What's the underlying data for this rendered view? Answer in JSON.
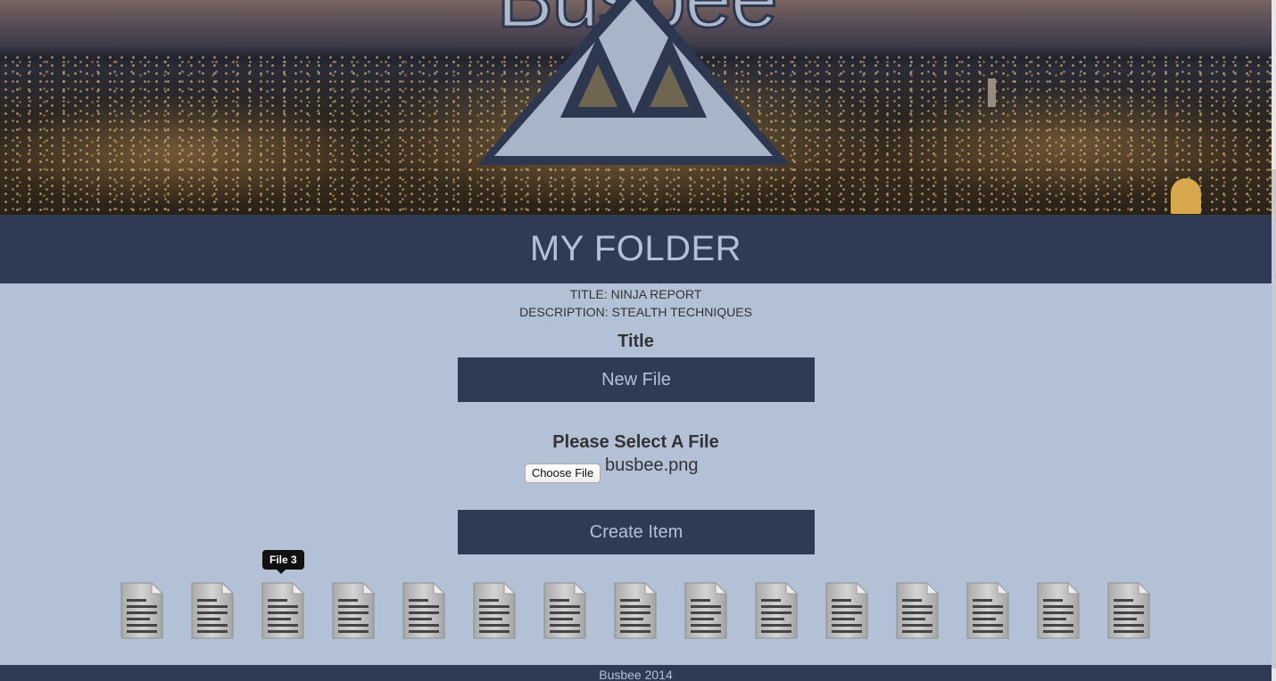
{
  "brand": {
    "name": "Busbee"
  },
  "page": {
    "title": "MY FOLDER"
  },
  "info": {
    "title_line": "TITLE: NINJA REPORT",
    "description_line": "DESCRIPTION: STEALTH TECHNIQUES"
  },
  "form": {
    "title_label": "Title",
    "new_file_button": "New File",
    "select_label": "Please Select A File",
    "choose_file_button": "Choose File",
    "selected_file": "busbee.png",
    "create_button": "Create Item"
  },
  "files": {
    "icon": "document-icon",
    "count": 15,
    "hovered_tooltip": "File 3"
  },
  "footer": {
    "text": "Busbee 2014"
  },
  "colors": {
    "primary": "#2f3b54",
    "background": "#b3c1d6",
    "text": "#333333"
  }
}
